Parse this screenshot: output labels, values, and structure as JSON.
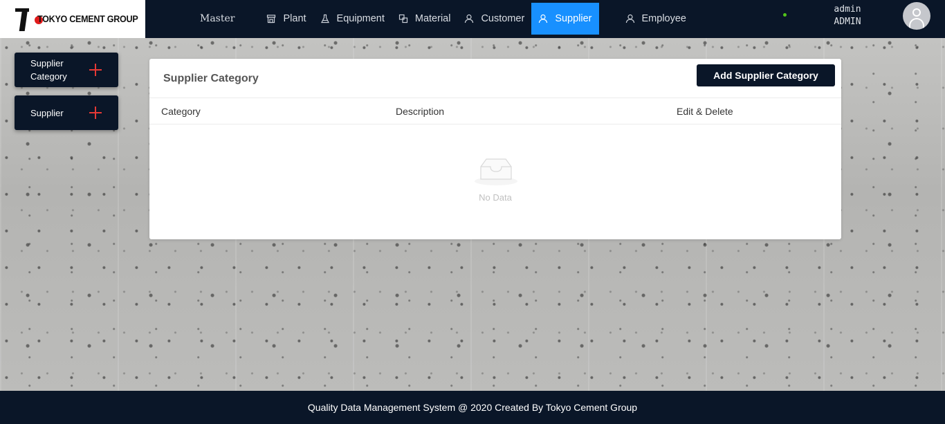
{
  "brand": {
    "name": "TOKYO CEMENT GROUP"
  },
  "nav": {
    "master": "Master",
    "items": [
      {
        "label": "Plant",
        "icon": "shop-icon"
      },
      {
        "label": "Equipment",
        "icon": "flask-icon"
      },
      {
        "label": "Material",
        "icon": "block-icon"
      },
      {
        "label": "Customer",
        "icon": "user-icon"
      },
      {
        "label": "Supplier",
        "icon": "user-icon",
        "active": true
      },
      {
        "label": "Employee",
        "icon": "user-icon"
      }
    ]
  },
  "user": {
    "name": "admin",
    "role": "ADMIN",
    "status_color": "#52c41a"
  },
  "sidebar": {
    "buttons": [
      {
        "label": "Supplier Category",
        "icon": "plus-icon"
      },
      {
        "label": "Supplier",
        "icon": "plus-icon"
      }
    ]
  },
  "card": {
    "title": "Supplier Category",
    "add_button": "Add Supplier Category",
    "columns": [
      "Category",
      "Description",
      "Edit & Delete"
    ],
    "empty_text": "No Data"
  },
  "footer": {
    "text": "Quality Data Management System @ 2020 Created By Tokyo Cement Group"
  },
  "colors": {
    "navy": "#0a1628",
    "accent": "#1890ff",
    "plus": "#e53935"
  }
}
